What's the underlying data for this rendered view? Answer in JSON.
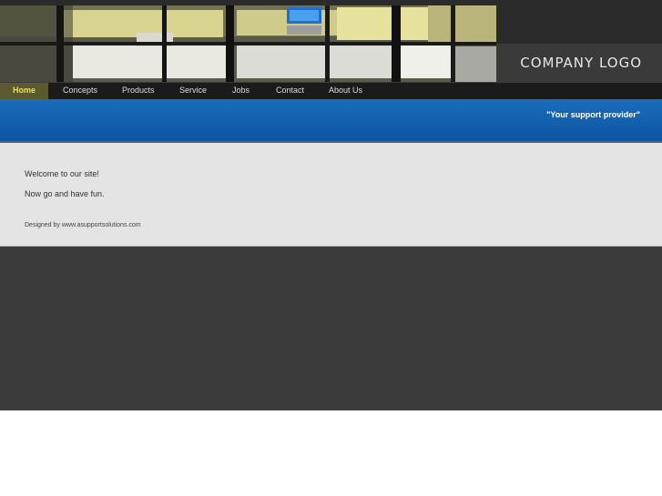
{
  "header": {
    "logo_text": "COMPANY LOGO",
    "banner_image": "office-workstations-photo"
  },
  "nav": {
    "items": [
      {
        "label": "Home",
        "active": true
      },
      {
        "label": "Concepts"
      },
      {
        "label": "Products"
      },
      {
        "label": "Service"
      },
      {
        "label": "Jobs"
      },
      {
        "label": "Contact"
      },
      {
        "label": "About Us"
      }
    ]
  },
  "band": {
    "tagline": "\"Your support provider\""
  },
  "content": {
    "welcome": "Welcome to our site!",
    "subtext": "Now go and have fun.",
    "credit": "Designed by www.asupportsolutions.com"
  },
  "colors": {
    "nav_active_bg": "#5b5a2e",
    "nav_active_text": "#f1e24a",
    "band_blue": "#1464b0",
    "content_bg": "#e4e4e4",
    "page_dark": "#3b3b3b"
  }
}
